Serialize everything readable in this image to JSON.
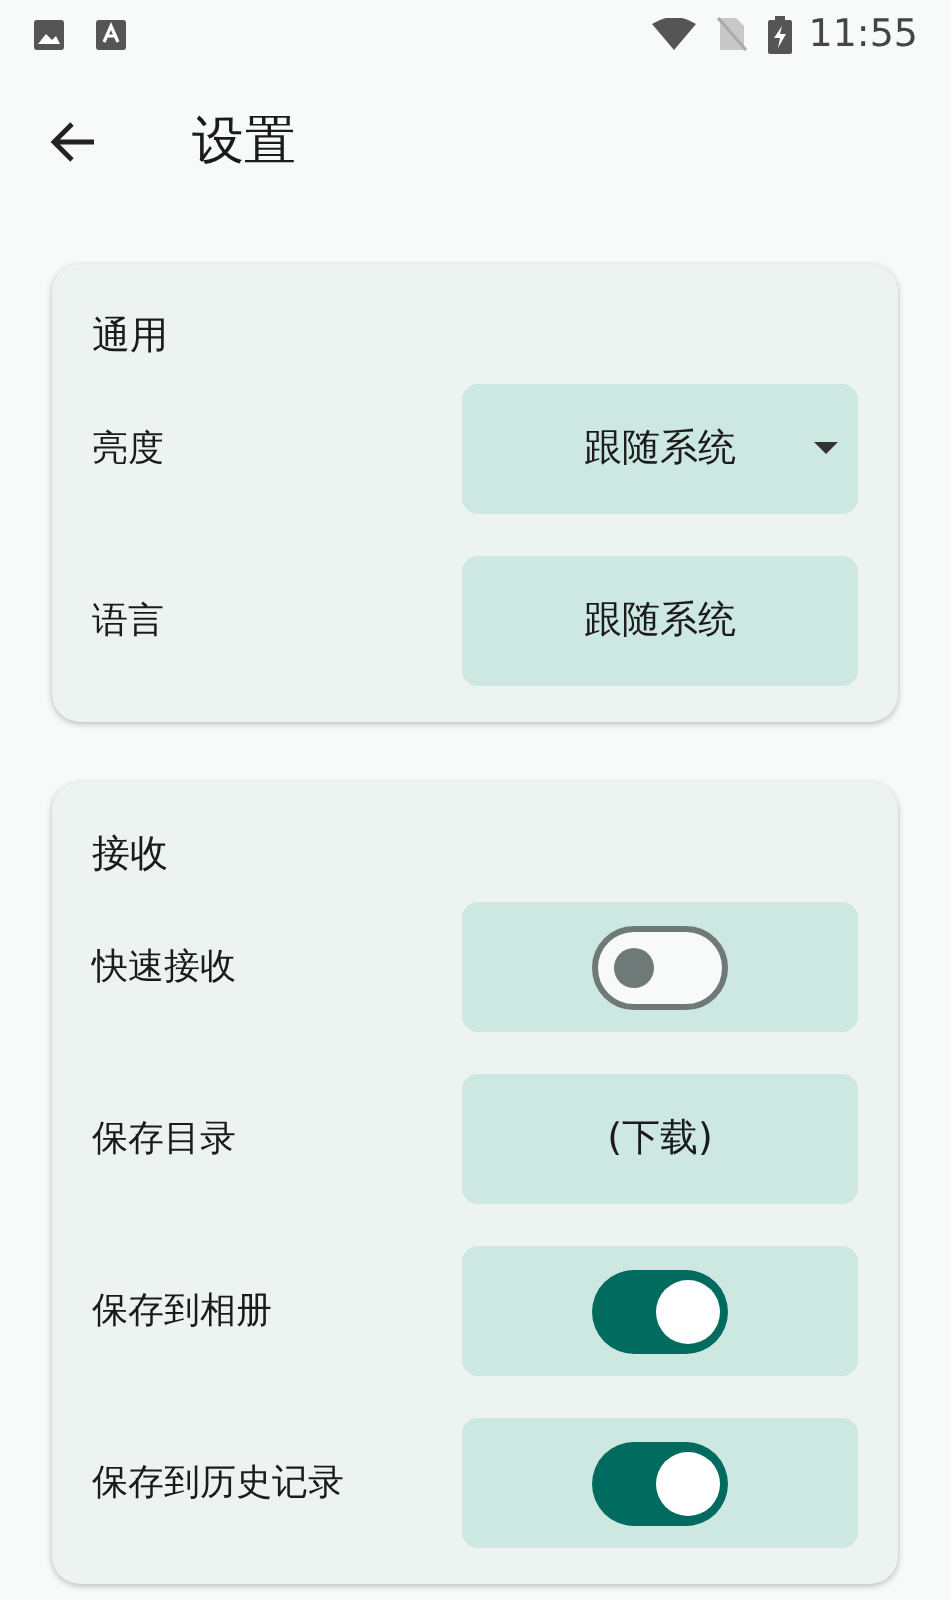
{
  "status_bar": {
    "time": "11:55"
  },
  "app_bar": {
    "title": "设置"
  },
  "sections": [
    {
      "title": "通用",
      "rows": [
        {
          "kind": "dropdown",
          "label": "亮度",
          "value": "跟随系统"
        },
        {
          "kind": "button",
          "label": "语言",
          "value": "跟随系统"
        }
      ]
    },
    {
      "title": "接收",
      "rows": [
        {
          "kind": "switch",
          "label": "快速接收",
          "on": false
        },
        {
          "kind": "button",
          "label": "保存目录",
          "value": "(下载)"
        },
        {
          "kind": "switch",
          "label": "保存到相册",
          "on": true
        },
        {
          "kind": "switch",
          "label": "保存到历史记录",
          "on": true
        }
      ]
    }
  ]
}
